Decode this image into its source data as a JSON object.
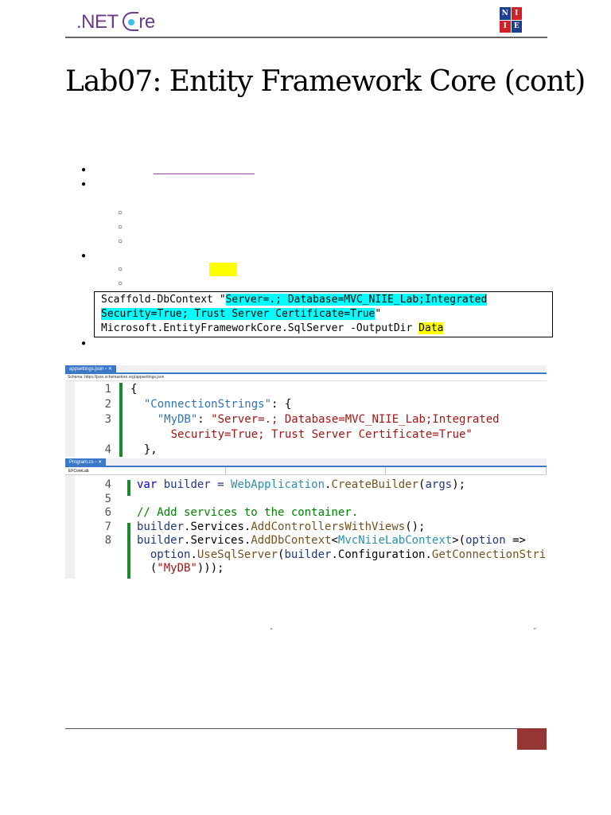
{
  "header": {
    "logo_text": ".NET Core",
    "logo_prefix": ".NET ",
    "logo_suffix": "re",
    "badge_letters": [
      "N",
      "I",
      "I",
      "E"
    ]
  },
  "title": "Lab07: Entity Framework Core (cont)",
  "command": {
    "prefix": "Scaffold-DbContext \"",
    "conn_line1": "Server=.; Database=MVC_NIIE_Lab;Integrated",
    "conn_line2": "Security=True; Trust Server Certificate=True",
    "suffix": "\"",
    "line3": "Microsoft.EntityFrameworkCore.SqlServer -OutputDir ",
    "output_dir": "Data"
  },
  "screenshot1": {
    "tab": "appsettings.json",
    "tab_controls": "▫ ✕",
    "schema": "Schema: https://json.schemastore.org/appsettings.json",
    "lines": [
      {
        "n": "1",
        "tokens": [
          {
            "t": "{",
            "c": "d"
          }
        ]
      },
      {
        "n": "2",
        "tokens": [
          {
            "t": "  \"ConnectionStrings\"",
            "c": "js"
          },
          {
            "t": ": {",
            "c": "d"
          }
        ]
      },
      {
        "n": "3",
        "tokens": [
          {
            "t": "    \"MyDB\"",
            "c": "js"
          },
          {
            "t": ": ",
            "c": "d"
          },
          {
            "t": "\"Server=.; Database=MVC_NIIE_Lab;Integrated",
            "c": "s"
          }
        ]
      },
      {
        "n": "",
        "tokens": [
          {
            "t": "      Security=True; Trust Server Certificate=True\"",
            "c": "s"
          }
        ]
      },
      {
        "n": "4",
        "tokens": [
          {
            "t": "  },",
            "c": "d"
          }
        ]
      }
    ]
  },
  "screenshot2": {
    "tab": "Program.cs",
    "tab_controls": "▫ ✕",
    "project": "EFCoreLab",
    "lines": [
      {
        "n": "4",
        "tokens": [
          {
            "t": "var",
            "c": "k"
          },
          {
            "t": " builder = ",
            "c": "p"
          },
          {
            "t": "WebApplication",
            "c": "t"
          },
          {
            "t": ".",
            "c": "d"
          },
          {
            "t": "CreateBuilder",
            "c": "m"
          },
          {
            "t": "(",
            "c": "d"
          },
          {
            "t": "args",
            "c": "p"
          },
          {
            "t": ");",
            "c": "d"
          }
        ]
      },
      {
        "n": "5",
        "tokens": []
      },
      {
        "n": "6",
        "tokens": [
          {
            "t": "// Add services to the container.",
            "c": "g"
          }
        ]
      },
      {
        "n": "7",
        "tokens": [
          {
            "t": "builder",
            "c": "p"
          },
          {
            "t": ".Services.",
            "c": "d"
          },
          {
            "t": "AddControllersWithViews",
            "c": "m"
          },
          {
            "t": "();",
            "c": "d"
          }
        ]
      },
      {
        "n": "8",
        "tokens": [
          {
            "t": "builder",
            "c": "p"
          },
          {
            "t": ".Services.",
            "c": "d"
          },
          {
            "t": "AddDbContext",
            "c": "m"
          },
          {
            "t": "<",
            "c": "d"
          },
          {
            "t": "MvcNiieLabContext",
            "c": "t"
          },
          {
            "t": ">(",
            "c": "d"
          },
          {
            "t": "option",
            "c": "p"
          },
          {
            "t": " =>",
            "c": "d"
          }
        ]
      },
      {
        "n": "",
        "tokens": [
          {
            "t": "  option",
            "c": "p"
          },
          {
            "t": ".",
            "c": "d"
          },
          {
            "t": "UseSqlServer",
            "c": "m"
          },
          {
            "t": "(",
            "c": "d"
          },
          {
            "t": "builder",
            "c": "p"
          },
          {
            "t": ".Configuration.",
            "c": "d"
          },
          {
            "t": "GetConnectionString",
            "c": "m"
          }
        ]
      },
      {
        "n": "",
        "tokens": [
          {
            "t": "  (",
            "c": "d"
          },
          {
            "t": "\"MyDB\"",
            "c": "s"
          },
          {
            "t": ")));",
            "c": "d"
          }
        ]
      }
    ]
  },
  "quotes": {
    "open": "“",
    "close": "”"
  }
}
